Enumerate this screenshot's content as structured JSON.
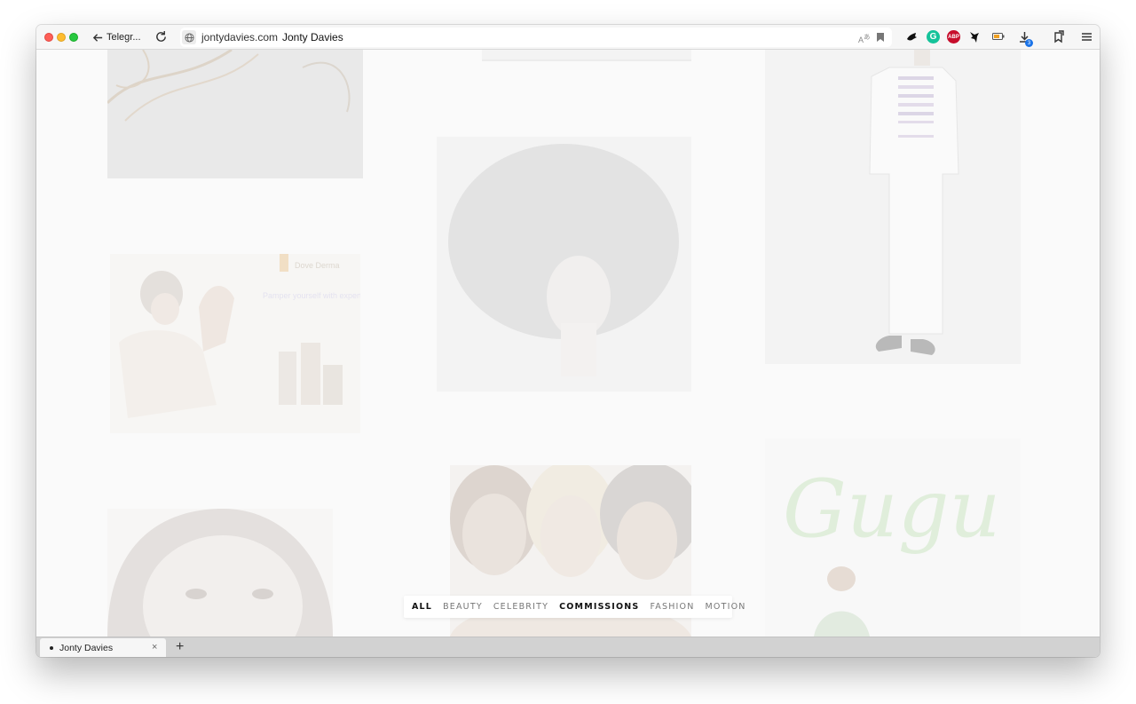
{
  "browser": {
    "back_label": "Telegr...",
    "url_domain": "jontydavies.com",
    "page_title": "Jonty Davies",
    "download_count": "3",
    "extensions": {
      "grammarly": "G",
      "adblock": "ABP"
    }
  },
  "gallery": {
    "tiles": [
      {
        "name": "gallery-tile-hair-dark"
      },
      {
        "name": "gallery-tile-top-strip"
      },
      {
        "name": "gallery-tile-white-suit"
      },
      {
        "name": "gallery-tile-skincare-ad",
        "brand": "Dove Derma",
        "copy": "Pamper yourself with expert care for soft healthy skin"
      },
      {
        "name": "gallery-tile-afro-portrait"
      },
      {
        "name": "gallery-tile-gugu",
        "logo_text": "Gugu"
      },
      {
        "name": "gallery-tile-woman-closeup"
      },
      {
        "name": "gallery-tile-three-women"
      }
    ]
  },
  "filters": {
    "items": [
      "ALL",
      "BEAUTY",
      "CELEBRITY",
      "COMMISSIONS",
      "FASHION",
      "MOTION"
    ]
  },
  "tabs": {
    "active_label": "Jonty Davies",
    "close": "×",
    "new_tab": "+"
  },
  "colors": {
    "filter_active": "#111111",
    "filter_inactive": "#777777",
    "gugu_green": "#d8ecd4",
    "download_badge": "#1a73e8"
  }
}
